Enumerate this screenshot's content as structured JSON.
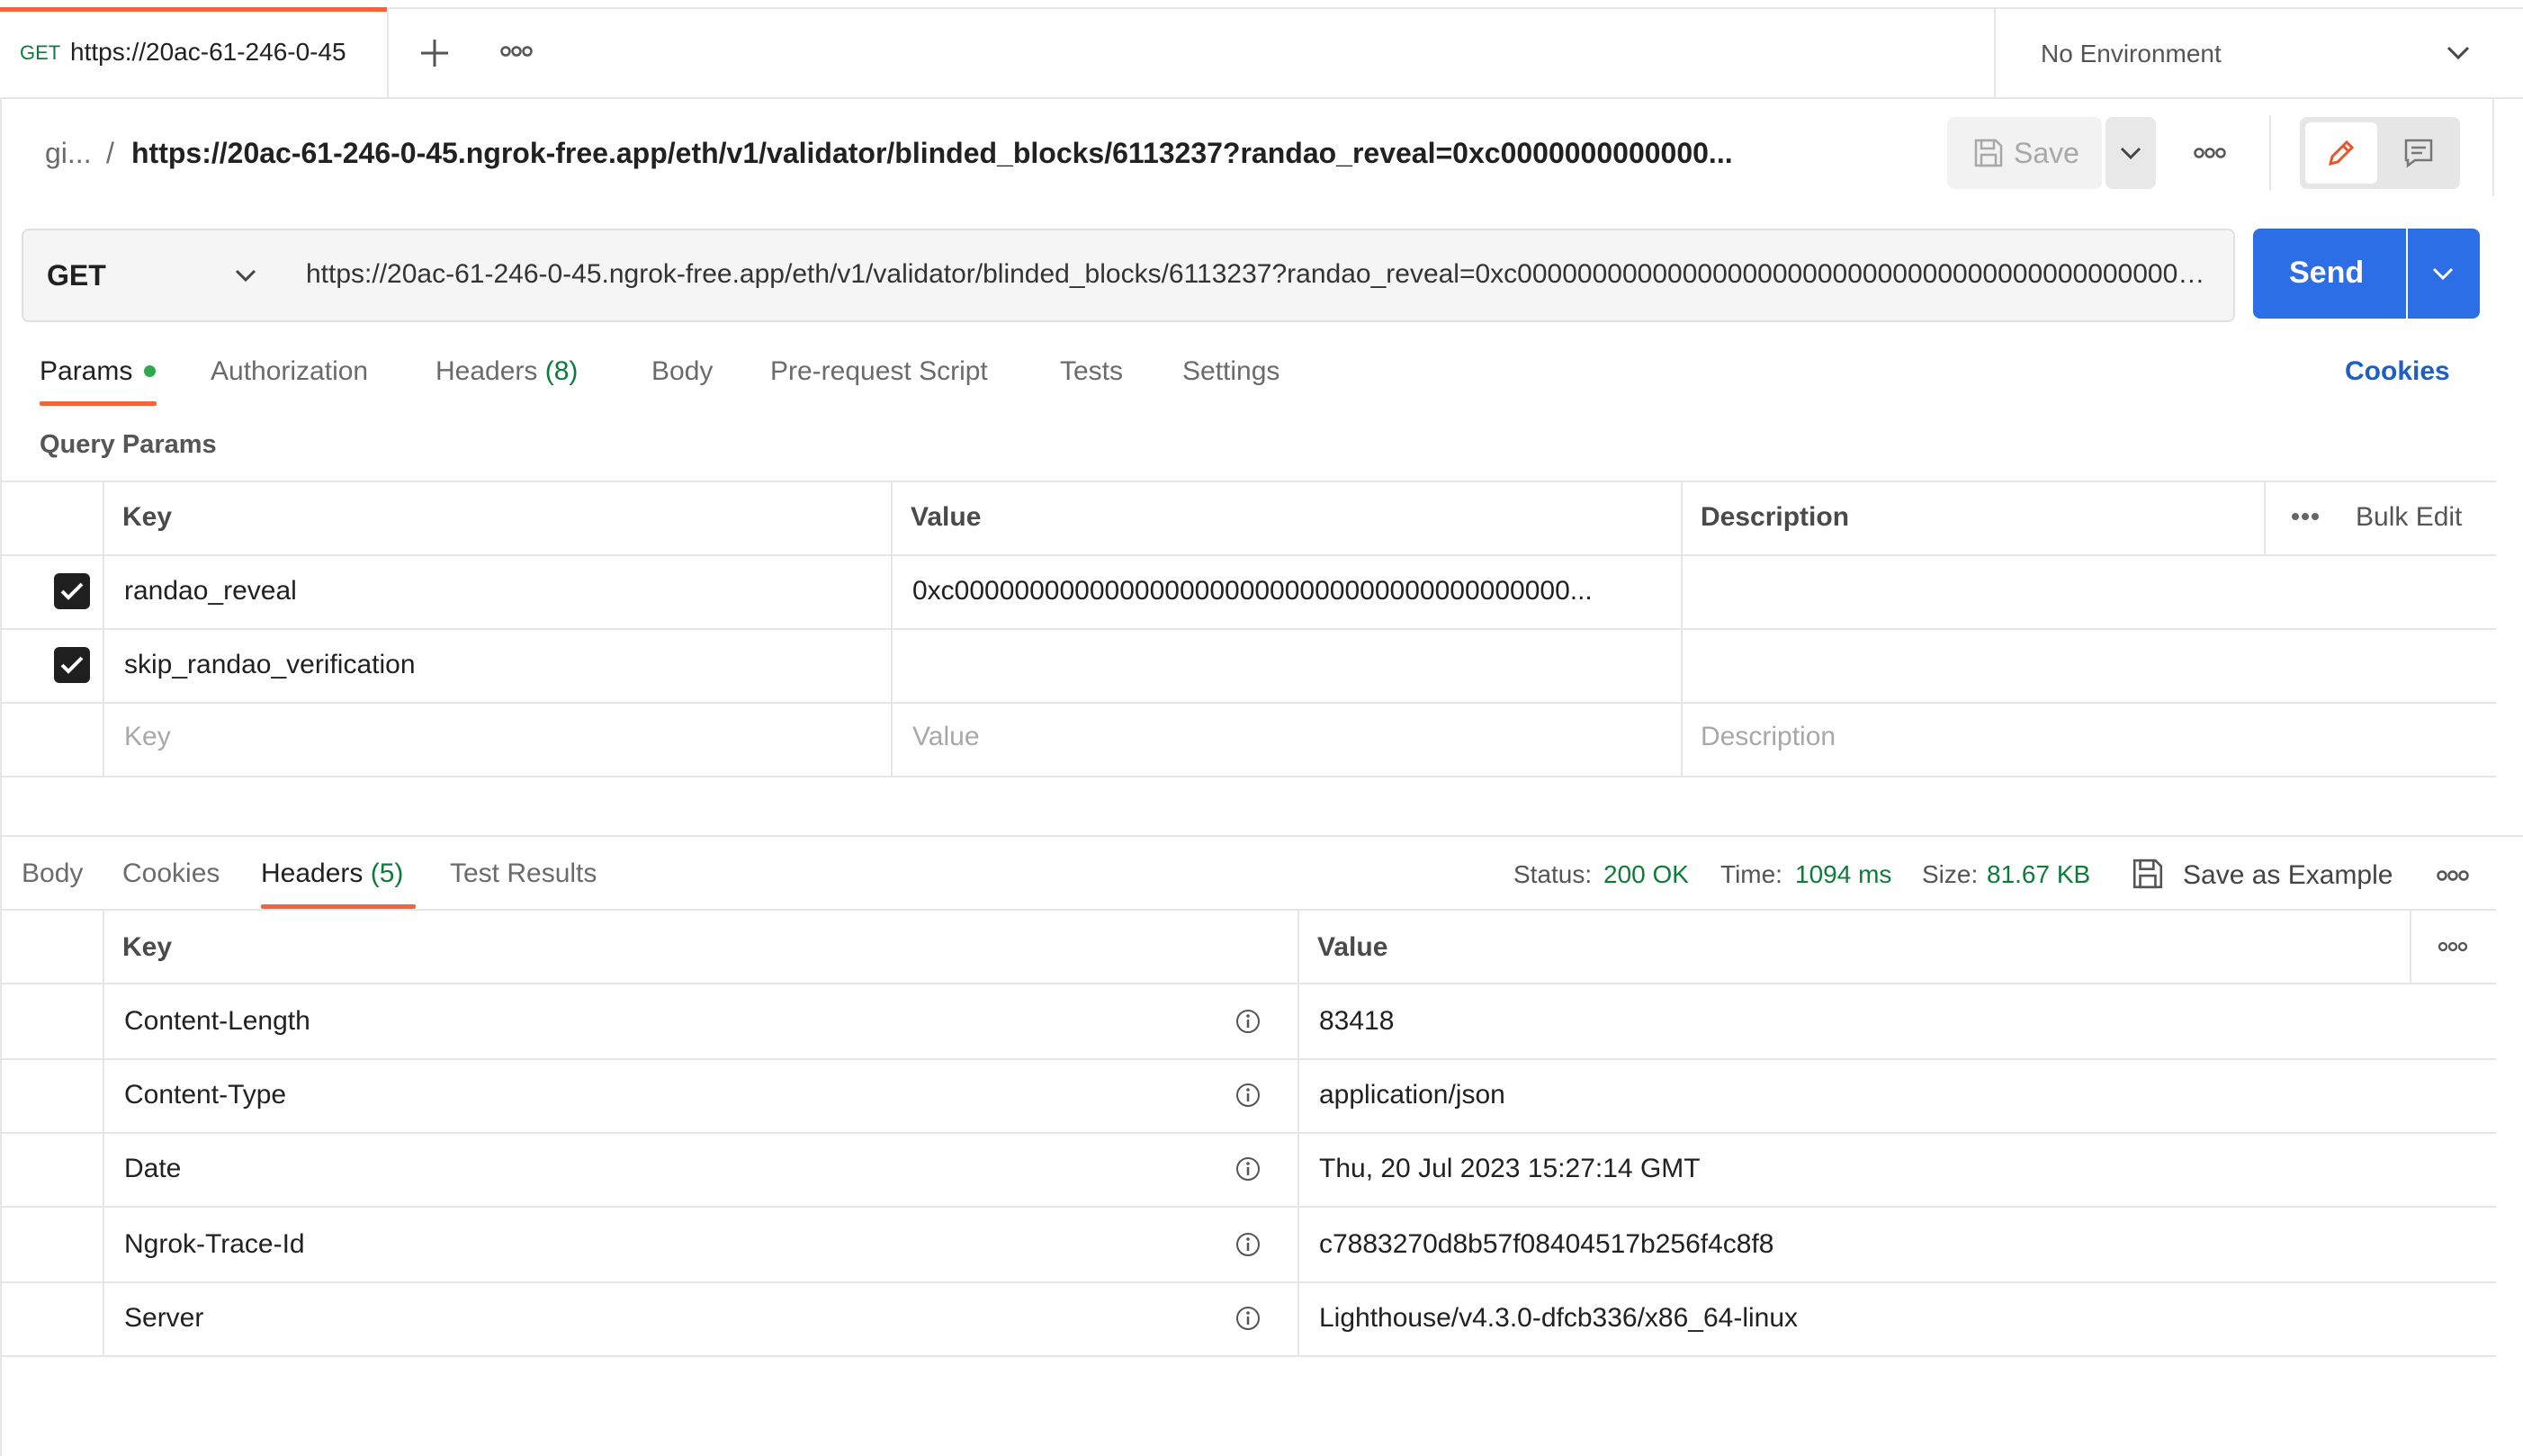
{
  "tabbar": {
    "tab_method": "GET",
    "tab_url": "https://20ac-61-246-0-45",
    "environment": "No Environment"
  },
  "header": {
    "breadcrumb_prefix": "gi...",
    "breadcrumb_sep": "/",
    "title": "https://20ac-61-246-0-45.ngrok-free.app/eth/v1/validator/blinded_blocks/6113237?randao_reveal=0xc0000000000000...",
    "save_label": "Save"
  },
  "request": {
    "method": "GET",
    "url": "https://20ac-61-246-0-45.ngrok-free.app/eth/v1/validator/blinded_blocks/6113237?randao_reveal=0xc00000000000000000000000000000000000000000000000000000000000000000000000",
    "send_label": "Send"
  },
  "request_tabs": {
    "params": "Params",
    "authorization": "Authorization",
    "headers": "Headers",
    "headers_count": "(8)",
    "body": "Body",
    "prerequest": "Pre-request Script",
    "tests": "Tests",
    "settings": "Settings",
    "cookies": "Cookies"
  },
  "query_params": {
    "title": "Query Params",
    "col_key": "Key",
    "col_value": "Value",
    "col_description": "Description",
    "bulk_edit": "Bulk Edit",
    "rows": [
      {
        "key": "randao_reveal",
        "value": "0xc00000000000000000000000000000000000000000...",
        "checked": true
      },
      {
        "key": "skip_randao_verification",
        "value": "",
        "checked": true
      }
    ],
    "placeholder_key": "Key",
    "placeholder_value": "Value",
    "placeholder_description": "Description"
  },
  "response": {
    "tabs": {
      "body": "Body",
      "cookies": "Cookies",
      "headers": "Headers",
      "headers_count": "(5)",
      "test_results": "Test Results"
    },
    "status_label": "Status:",
    "status_value": "200 OK",
    "time_label": "Time:",
    "time_value": "1094 ms",
    "size_label": "Size:",
    "size_value": "81.67 KB",
    "save_example": "Save as Example",
    "col_key": "Key",
    "col_value": "Value",
    "headers": [
      {
        "key": "Content-Length",
        "value": "83418"
      },
      {
        "key": "Content-Type",
        "value": "application/json"
      },
      {
        "key": "Date",
        "value": "Thu, 20 Jul 2023 15:27:14 GMT"
      },
      {
        "key": "Ngrok-Trace-Id",
        "value": "c7883270d8b57f08404517b256f4c8f8"
      },
      {
        "key": "Server",
        "value": "Lighthouse/v4.3.0-dfcb336/x86_64-linux"
      }
    ]
  },
  "colors": {
    "accent": "#f0653b",
    "primary_button": "#2b6ee6",
    "success": "#0f7b3a",
    "link": "#1f5fc4"
  }
}
